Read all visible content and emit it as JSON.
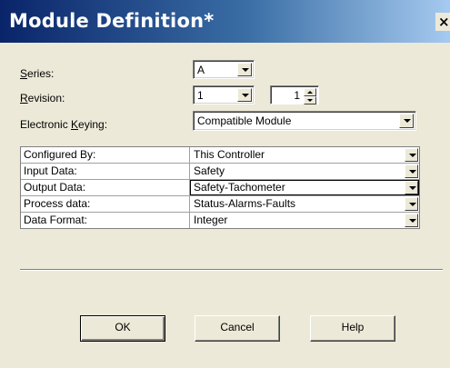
{
  "window": {
    "title": "Module Definition*",
    "close_label": "×",
    "title_gradient": [
      "#0a246a",
      "#3a6ea5",
      "#a6caf0"
    ]
  },
  "form": {
    "series": {
      "label_prefix": "",
      "label_mnemonic": "S",
      "label_rest": "eries:",
      "value": "A"
    },
    "revision": {
      "label_mnemonic": "R",
      "label_rest": "evision:",
      "major": "1",
      "minor": "1"
    },
    "keying": {
      "label_prefix": "Electronic ",
      "label_mnemonic": "K",
      "label_rest": "eying:",
      "value": "Compatible Module"
    }
  },
  "grid": {
    "rows": [
      {
        "label": "Configured By:",
        "value": "This Controller",
        "active": false
      },
      {
        "label": "Input Data:",
        "value": "Safety",
        "active": false
      },
      {
        "label": "Output Data:",
        "value": "Safety-Tachometer",
        "active": true
      },
      {
        "label": "Process data:",
        "value": "Status-Alarms-Faults",
        "active": false
      },
      {
        "label": "Data Format:",
        "value": "Integer",
        "active": false
      }
    ]
  },
  "buttons": {
    "ok": "OK",
    "cancel": "Cancel",
    "help": "Help"
  }
}
